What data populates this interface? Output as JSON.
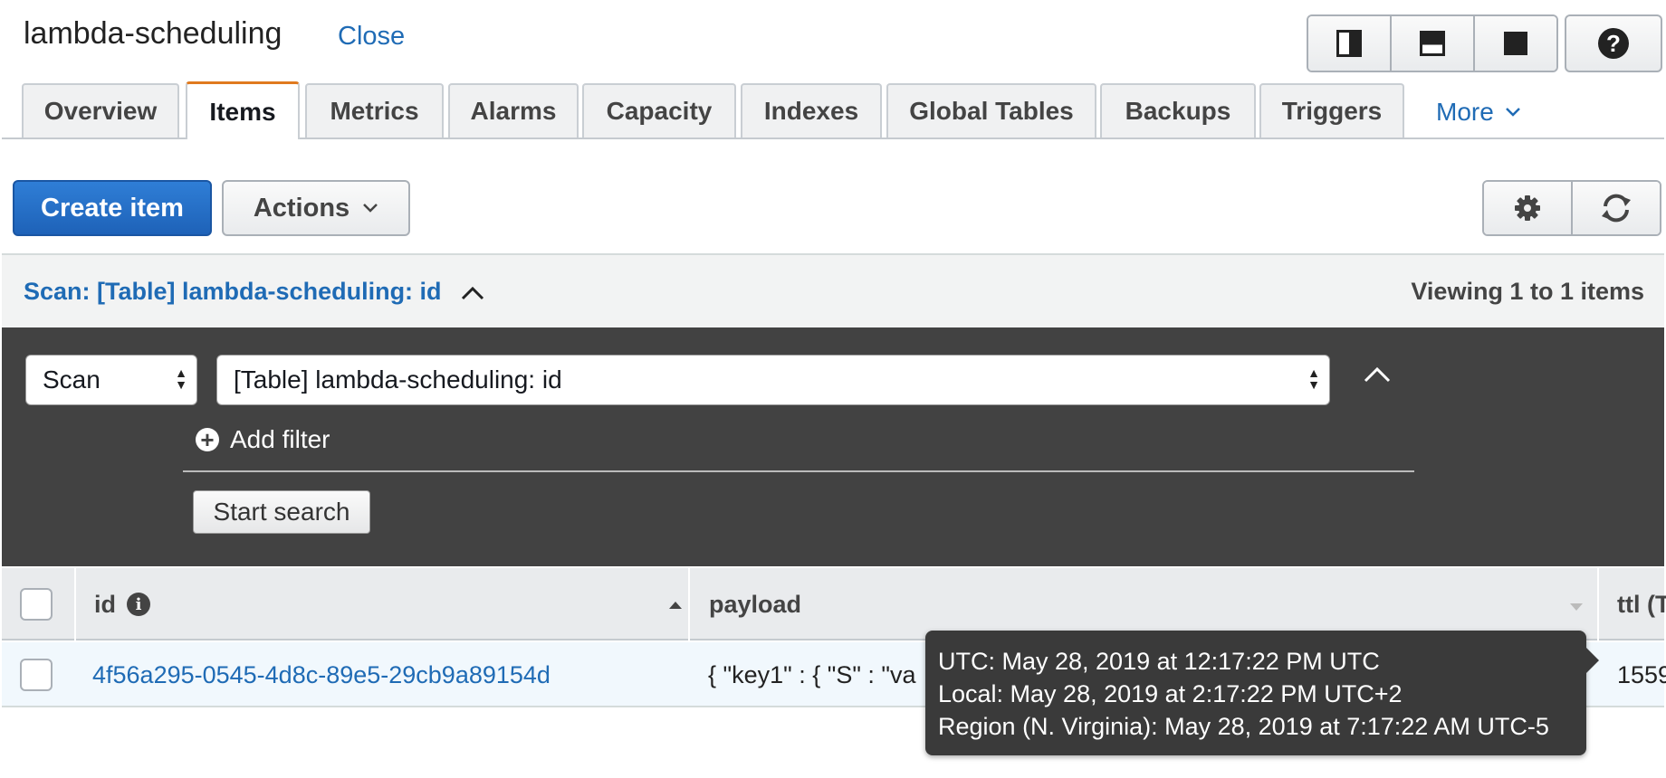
{
  "header": {
    "title": "lambda-scheduling",
    "close_label": "Close",
    "view_icons": [
      "split-vertical-icon",
      "split-horizontal-icon",
      "full-panel-icon"
    ],
    "help_icon": "help-icon",
    "help_glyph": "?"
  },
  "tabs": [
    {
      "label": "Overview"
    },
    {
      "label": "Items",
      "active": true
    },
    {
      "label": "Metrics"
    },
    {
      "label": "Alarms"
    },
    {
      "label": "Capacity"
    },
    {
      "label": "Indexes"
    },
    {
      "label": "Global Tables"
    },
    {
      "label": "Backups"
    },
    {
      "label": "Triggers"
    }
  ],
  "tabs_more_label": "More",
  "toolbar": {
    "create_label": "Create item",
    "actions_label": "Actions",
    "settings_icon": "gear-icon",
    "refresh_icon": "refresh-icon"
  },
  "scan_header": {
    "title": "Scan: [Table] lambda-scheduling: id",
    "viewing": "Viewing 1 to 1 items"
  },
  "filter_panel": {
    "mode_value": "Scan",
    "index_value": "[Table] lambda-scheduling: id",
    "add_filter_label": "Add filter",
    "start_search_label": "Start search"
  },
  "table": {
    "columns": [
      {
        "label": "id",
        "sorted": "asc"
      },
      {
        "label": "payload"
      },
      {
        "label": "ttl (T"
      }
    ],
    "rows": [
      {
        "id": "4f56a295-0545-4d8c-89e5-29cb9a89154d",
        "payload": "{ \"key1\" : { \"S\" : \"va",
        "ttl": "1559"
      }
    ]
  },
  "tooltip": {
    "utc": "UTC: May 28, 2019 at 12:17:22 PM UTC",
    "local": "Local: May 28, 2019 at 2:17:22 PM UTC+2",
    "region": "Region (N. Virginia): May 28, 2019 at 7:17:22 AM UTC-5"
  },
  "colors": {
    "accent_link": "#1f6bb5",
    "primary_button": "#1e62b8",
    "active_tab_border": "#e07a1f",
    "panel_bg": "#424242"
  }
}
